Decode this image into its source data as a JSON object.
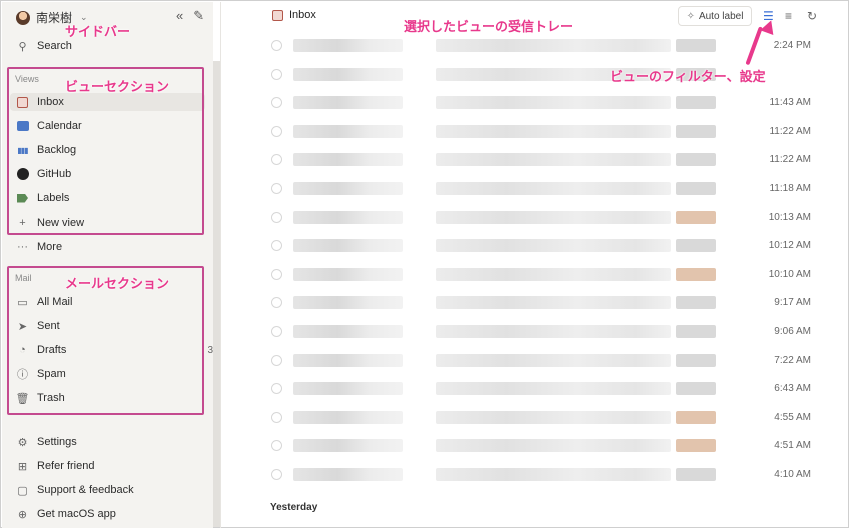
{
  "sidebar": {
    "user_name": "南栄樹",
    "search_label": "Search",
    "views_label": "Views",
    "views": [
      {
        "label": "Inbox",
        "icon": "inbox-icon"
      },
      {
        "label": "Calendar",
        "icon": "calendar-icon"
      },
      {
        "label": "Backlog",
        "icon": "backlog-icon"
      },
      {
        "label": "GitHub",
        "icon": "github-icon"
      },
      {
        "label": "Labels",
        "icon": "label-icon"
      },
      {
        "label": "New view",
        "icon": "plus-icon"
      }
    ],
    "more_label": "More",
    "mail_label": "Mail",
    "mail": [
      {
        "label": "All Mail",
        "icon": "all-mail-icon"
      },
      {
        "label": "Sent",
        "icon": "send-icon"
      },
      {
        "label": "Drafts",
        "icon": "drafts-icon",
        "count": "3"
      },
      {
        "label": "Spam",
        "icon": "spam-icon"
      },
      {
        "label": "Trash",
        "icon": "trash-icon"
      }
    ],
    "footer": [
      {
        "label": "Settings",
        "icon": "gear-icon"
      },
      {
        "label": "Refer friend",
        "icon": "gift-icon"
      },
      {
        "label": "Support & feedback",
        "icon": "chat-icon"
      },
      {
        "label": "Get macOS app",
        "icon": "download-icon"
      }
    ]
  },
  "main": {
    "title": "Inbox",
    "auto_label": "Auto label",
    "messages": [
      {
        "time": "2:24 PM",
        "warm": false
      },
      {
        "time": "",
        "warm": false
      },
      {
        "time": "11:43 AM",
        "warm": false
      },
      {
        "time": "11:22 AM",
        "warm": false
      },
      {
        "time": "11:22 AM",
        "warm": false
      },
      {
        "time": "11:18 AM",
        "warm": false
      },
      {
        "time": "10:13 AM",
        "warm": true
      },
      {
        "time": "10:12 AM",
        "warm": false
      },
      {
        "time": "10:10 AM",
        "warm": true
      },
      {
        "time": "9:17 AM",
        "warm": false
      },
      {
        "time": "9:06 AM",
        "warm": false
      },
      {
        "time": "7:22 AM",
        "warm": false
      },
      {
        "time": "6:43 AM",
        "warm": false
      },
      {
        "time": "4:55 AM",
        "warm": true
      },
      {
        "time": "4:51 AM",
        "warm": true
      },
      {
        "time": "4:10 AM",
        "warm": false
      }
    ],
    "yesterday_label": "Yesterday"
  },
  "annotations": {
    "sidebar": "サイドバー",
    "views_section": "ビューセクション",
    "mail_section": "メールセクション",
    "inbox_view": "選択したビューの受信トレー",
    "view_filter": "ビューのフィルター、設定"
  },
  "colors": {
    "annotation": "#e8398c",
    "highlight_border": "#c44a8f",
    "sidebar_bg": "#f4f3f0"
  }
}
